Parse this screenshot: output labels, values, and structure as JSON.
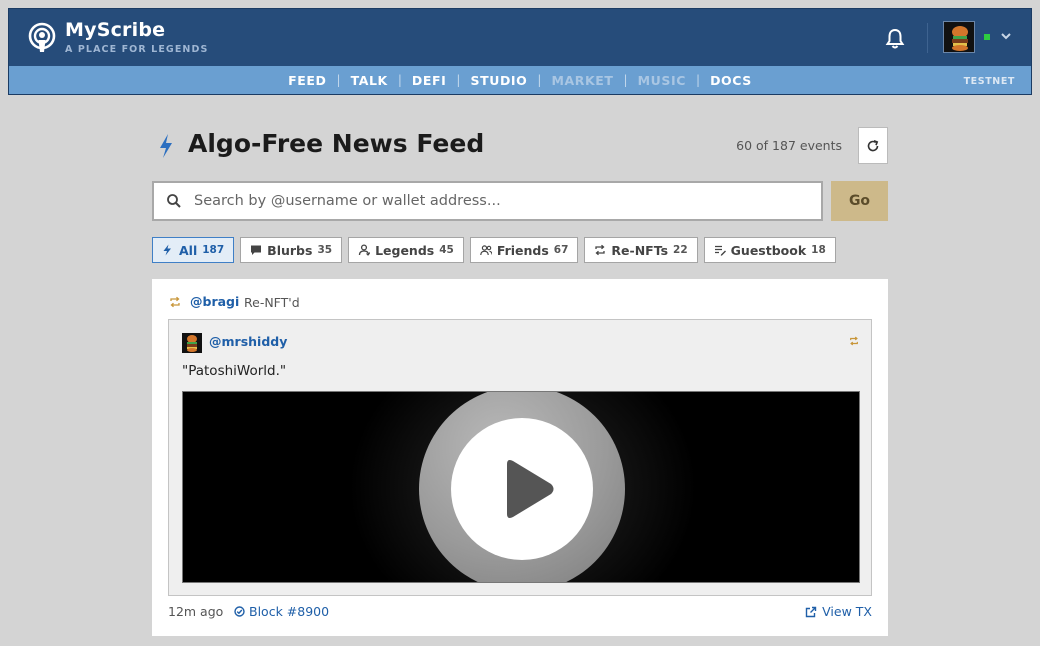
{
  "app": {
    "name": "MyScribe",
    "tagline": "A PLACE FOR LEGENDS",
    "network_badge": "TESTNET"
  },
  "nav": {
    "items": [
      {
        "label": "FEED",
        "enabled": true
      },
      {
        "label": "TALK",
        "enabled": true
      },
      {
        "label": "DEFI",
        "enabled": true
      },
      {
        "label": "STUDIO",
        "enabled": true
      },
      {
        "label": "MARKET",
        "enabled": false
      },
      {
        "label": "MUSIC",
        "enabled": false
      },
      {
        "label": "DOCS",
        "enabled": true
      }
    ],
    "separator": "|"
  },
  "user_menu": {
    "status": "online",
    "status_color": "#2ecc40"
  },
  "feed": {
    "title": "Algo-Free News Feed",
    "events_count": "60 of 187 events"
  },
  "search": {
    "placeholder": "Search by @username or wallet address...",
    "value": "",
    "go_label": "Go"
  },
  "filters": [
    {
      "label": "All",
      "count": "187",
      "icon": "bolt-icon",
      "active": true
    },
    {
      "label": "Blurbs",
      "count": "35",
      "icon": "speech-bubble-icon",
      "active": false
    },
    {
      "label": "Legends",
      "count": "45",
      "icon": "user-icon",
      "active": false
    },
    {
      "label": "Friends",
      "count": "67",
      "icon": "friends-icon",
      "active": false
    },
    {
      "label": "Re-NFTs",
      "count": "22",
      "icon": "repost-icon",
      "active": false
    },
    {
      "label": "Guestbook",
      "count": "18",
      "icon": "guestbook-icon",
      "active": false
    }
  ],
  "post": {
    "reposter": "@bragi",
    "action": "Re-NFT'd",
    "original_author": "@mrshiddy",
    "text": "\"PatoshiWorld.\"",
    "media_type": "video",
    "time_ago": "12m ago",
    "block": "Block #8900",
    "view_tx": "View TX"
  },
  "colors": {
    "topbar": "#264c7a",
    "navbar": "#6a9fd1",
    "accent": "#1f5fa8",
    "go_button": "#cdb98a",
    "repost_icon": "#c8963a"
  }
}
